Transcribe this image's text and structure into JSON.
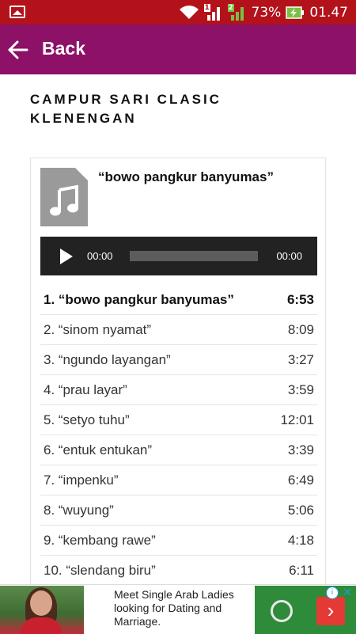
{
  "status_bar": {
    "battery_percent": "73%",
    "time": "01.47",
    "sim1_badge": "1",
    "sim2_badge": "2",
    "icons": [
      "gallery-icon",
      "wifi-icon",
      "signal-icon",
      "battery-charging-icon"
    ]
  },
  "app_bar": {
    "back_label": "Back",
    "color": "#8c1167"
  },
  "post": {
    "title": "CAMPUR SARI CLASIC KLENENGAN"
  },
  "playlist": {
    "current_title": "“bowo pangkur banyumas”",
    "player": {
      "current_time": "00:00",
      "duration": "00:00"
    },
    "tracks": [
      {
        "label": "1. “bowo pangkur banyumas”",
        "duration": "6:53"
      },
      {
        "label": "2. “sinom nyamat”",
        "duration": "8:09"
      },
      {
        "label": "3. “ngundo layangan”",
        "duration": "3:27"
      },
      {
        "label": "4. “prau layar”",
        "duration": "3:59"
      },
      {
        "label": "5. “setyo tuhu”",
        "duration": "12:01"
      },
      {
        "label": "6. “entuk entukan”",
        "duration": "3:39"
      },
      {
        "label": "7. “impenku”",
        "duration": "6:49"
      },
      {
        "label": "8. “wuyung”",
        "duration": "5:06"
      },
      {
        "label": "9. “kembang rawe”",
        "duration": "4:18"
      },
      {
        "label": "10. “slendang biru”",
        "duration": "6:11"
      }
    ]
  },
  "ad": {
    "text": "Meet Single Arab Ladies looking for Dating and Marriage.",
    "info_symbol": "i",
    "close_symbol": "✕",
    "cta_symbol": "›"
  }
}
